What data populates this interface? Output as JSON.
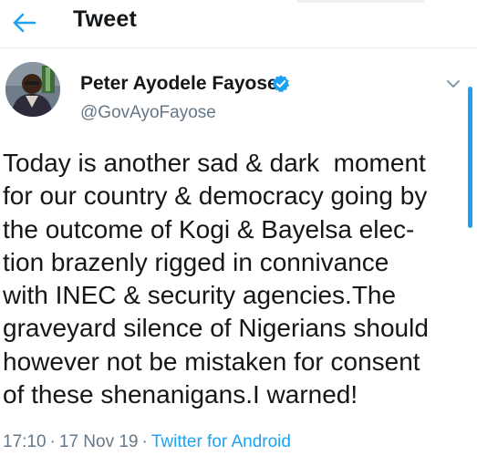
{
  "header": {
    "title": "Tweet",
    "back_icon": "arrow-left-icon"
  },
  "tweet": {
    "author_name": "Peter Ayodele Fayose",
    "author_handle": "@GovAyoFayose",
    "verified_icon": "verified-badge-icon",
    "menu_icon": "chevron-down-icon",
    "text_lines": [
      "Today is another sad & dark  moment",
      "for our country & democracy going by",
      "the outcome of Kogi & Bayelsa elec-",
      "tion brazenly rigged in connivance",
      "with INEC & security agencies.The",
      "graveyard silence of Nigerians should",
      "however not be mistaken for consent",
      "of these shenanigans.I warned!"
    ],
    "time": "17:10",
    "separator": "·",
    "date": "17 Nov 19",
    "source": "Twitter for Android"
  },
  "colors": {
    "accent": "#1da1f2",
    "text": "#14171a",
    "secondary_text": "#657786",
    "divider": "#e6ecf0"
  }
}
